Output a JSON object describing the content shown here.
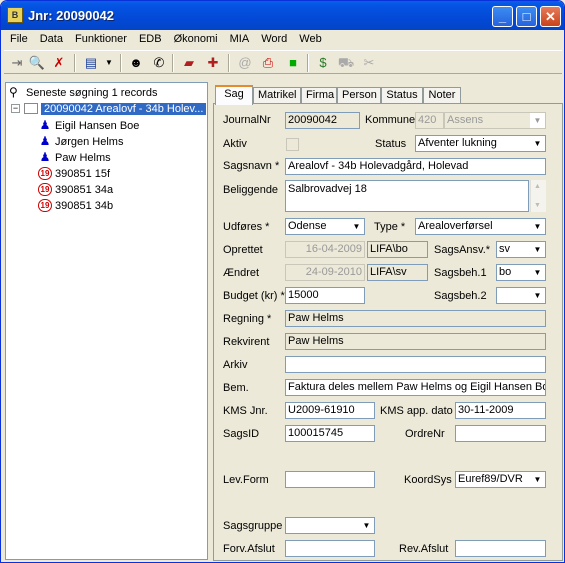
{
  "window": {
    "title": "Jnr: 20090042",
    "app_icon_text": "B"
  },
  "menu": [
    "File",
    "Data",
    "Funktioner",
    "EDB",
    "Økonomi",
    "MIA",
    "Word",
    "Web"
  ],
  "tree": {
    "header": "Seneste søgning 1 records",
    "root": "20090042 Arealovf - 34b Holev...",
    "persons": [
      "Eigil Hansen Boe",
      "Jørgen Helms",
      "Paw Helms"
    ],
    "matrikler": [
      "390851 15f",
      "390851 34a",
      "390851 34b"
    ],
    "matrikel_badge": "19"
  },
  "tabs": [
    "Sag",
    "Matrikel",
    "Firma",
    "Person",
    "Status",
    "Noter"
  ],
  "form": {
    "journalnr_label": "JournalNr",
    "journalnr": "20090042",
    "kommune_label": "Kommune",
    "kommune_code": "420",
    "kommune_name": "Assens",
    "aktiv_label": "Aktiv",
    "status_label": "Status",
    "status": "Afventer lukning",
    "sagsnavn_label": "Sagsnavn *",
    "sagsnavn": "Arealovf - 34b Holevadgård, Holevad",
    "beliggende_label": "Beliggende",
    "beliggende": "Salbrovadvej 18",
    "udfores_label": "Udføres *",
    "udfores": "Odense",
    "type_label": "Type *",
    "type": "Arealoverførsel",
    "oprettet_label": "Oprettet",
    "oprettet_date": "16-04-2009",
    "oprettet_user": "LIFA\\bo",
    "sagsansv_label": "SagsAnsv.*",
    "sagsansv": "sv",
    "aendret_label": "Ændret",
    "aendret_date": "24-09-2010",
    "aendret_user": "LIFA\\sv",
    "sagsbeh1_label": "Sagsbeh.1",
    "sagsbeh1": "bo",
    "budget_label": "Budget (kr) *",
    "budget": "15000",
    "sagsbeh2_label": "Sagsbeh.2",
    "sagsbeh2": "",
    "regning_label": "Regning *",
    "regning": "Paw Helms",
    "rekvirent_label": "Rekvirent",
    "rekvirent": "Paw Helms",
    "arkiv_label": "Arkiv",
    "arkiv": "",
    "bem_label": "Bem.",
    "bem": "Faktura deles mellem Paw Helms og Eigil Hansen Boe",
    "kmsjnr_label": "KMS Jnr.",
    "kmsjnr": "U2009-61910",
    "kmsdato_label": "KMS app. dato",
    "kmsdato": "30-11-2009",
    "sagsid_label": "SagsID",
    "sagsid": "100015745",
    "ordrenr_label": "OrdreNr",
    "ordrenr": "",
    "levform_label": "Lev.Form",
    "levform": "",
    "koordsys_label": "KoordSys",
    "koordsys": "Euref89/DVR",
    "sagsgruppe_label": "Sagsgruppe",
    "sagsgruppe": "",
    "forvafslut_label": "Forv.Afslut",
    "forvafslut": "",
    "revafslut_label": "Rev.Afslut",
    "revafslut": ""
  }
}
